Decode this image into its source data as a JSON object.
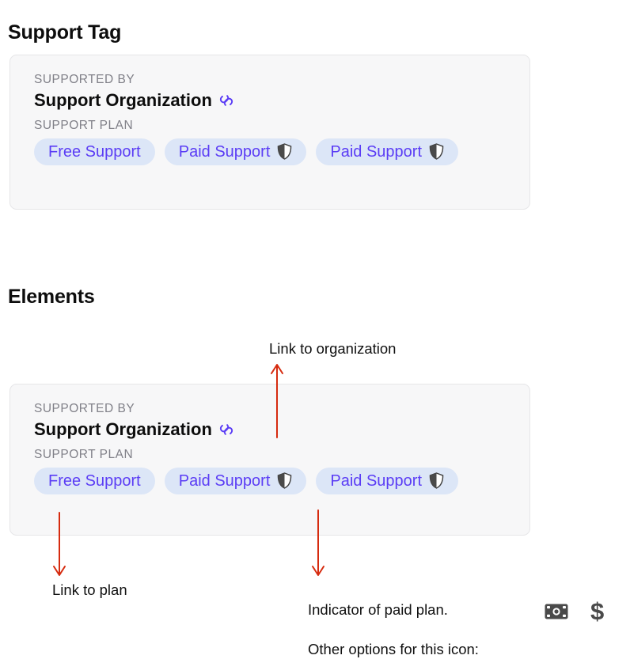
{
  "sections": {
    "support_tag_heading": "Support Tag",
    "elements_heading": "Elements"
  },
  "support_card": {
    "supported_by_label": "SUPPORTED BY",
    "organization_name": "Support Organization",
    "link_icon": "link-icon",
    "support_plan_label": "SUPPORT PLAN",
    "plans": [
      {
        "label": "Free Support",
        "paid": false,
        "icon": ""
      },
      {
        "label": "Paid Support",
        "paid": true,
        "icon": "shield-half-icon"
      },
      {
        "label": "Paid Support",
        "paid": true,
        "icon": "shield-half-icon"
      }
    ]
  },
  "annotations": {
    "link_to_organization": "Link to organization",
    "link_to_plan": "Link to plan",
    "paid_indicator_line1": "Indicator of paid plan.",
    "paid_indicator_line2": "Other options for this icon:",
    "icon_options": [
      {
        "name": "money-bill-icon",
        "glyph": "banknote"
      },
      {
        "name": "dollar-sign-icon",
        "glyph": "$"
      }
    ]
  },
  "colors": {
    "card_background": "#f7f7f8",
    "card_border": "#e6e6e8",
    "pill_background": "#dce6f7",
    "pill_text": "#5b3df5",
    "link_icon": "#5b3df5",
    "shield_dark": "#4a4a4a",
    "eyebrow_text": "#808088",
    "annotation_arrow": "#d62b0f",
    "heading_text": "#0d0d0d",
    "icon_gray": "#4a4a4a"
  }
}
